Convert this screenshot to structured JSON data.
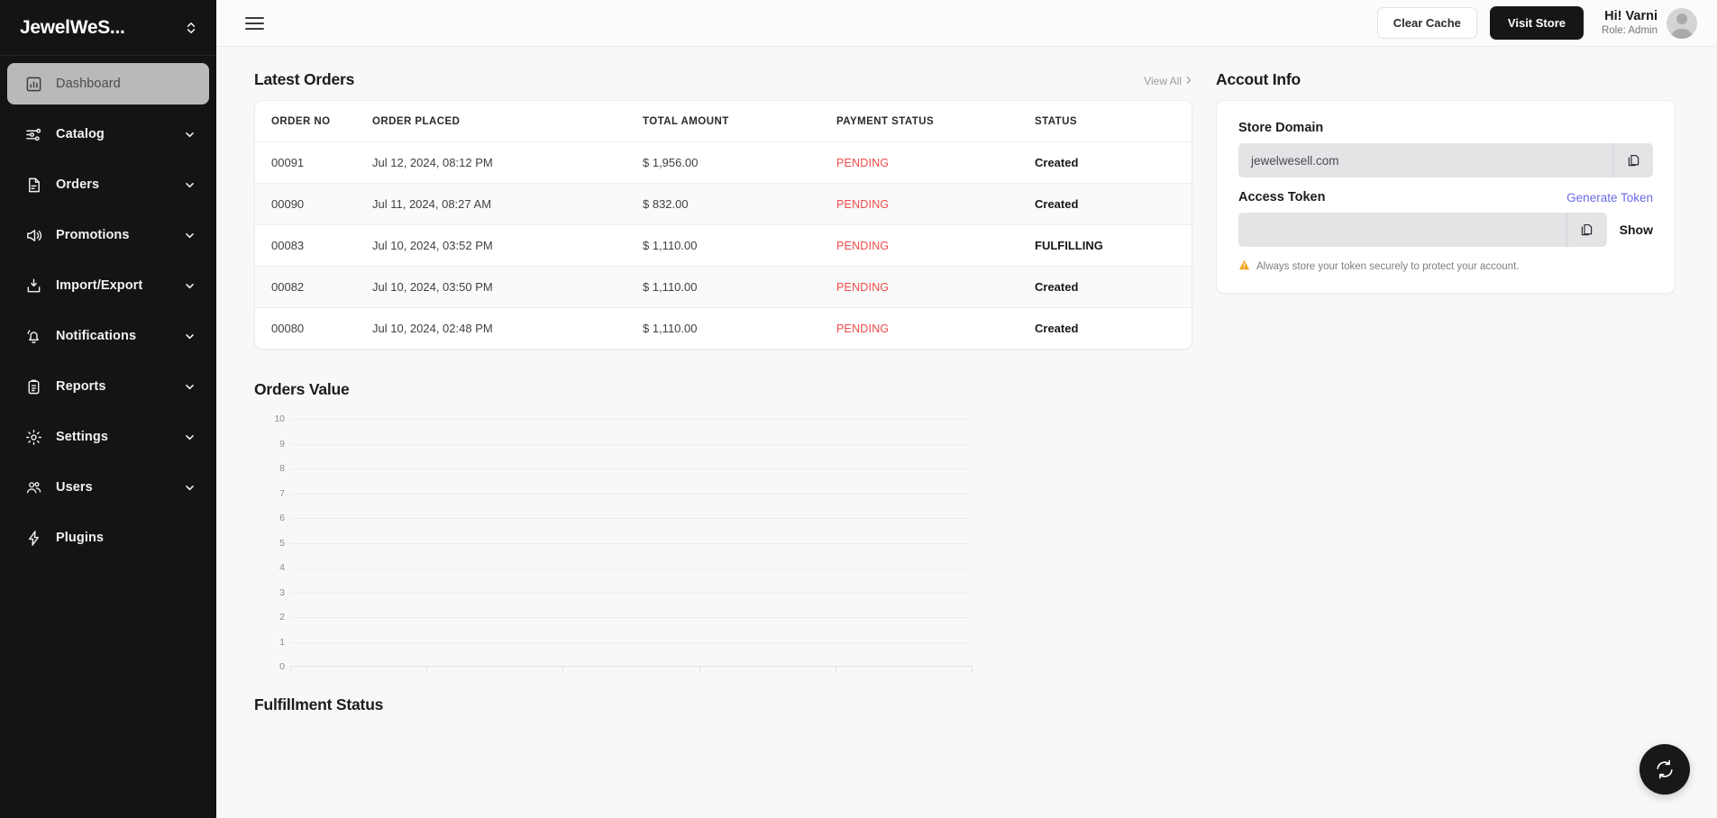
{
  "sidebar": {
    "brand": "JewelWeS...",
    "toggle_icon": "chevron-up-down-icon",
    "items": [
      {
        "label": "Dashboard",
        "icon": "chart-bar-icon",
        "active": true,
        "chevron": false
      },
      {
        "label": "Catalog",
        "icon": "sliders-icon",
        "active": false,
        "chevron": true
      },
      {
        "label": "Orders",
        "icon": "document-icon",
        "active": false,
        "chevron": true
      },
      {
        "label": "Promotions",
        "icon": "megaphone-icon",
        "active": false,
        "chevron": true
      },
      {
        "label": "Import/Export",
        "icon": "download-box-icon",
        "active": false,
        "chevron": true
      },
      {
        "label": "Notifications",
        "icon": "bell-icon",
        "active": false,
        "chevron": true
      },
      {
        "label": "Reports",
        "icon": "clipboard-icon",
        "active": false,
        "chevron": true
      },
      {
        "label": "Settings",
        "icon": "gear-icon",
        "active": false,
        "chevron": true
      },
      {
        "label": "Users",
        "icon": "users-icon",
        "active": false,
        "chevron": true
      },
      {
        "label": "Plugins",
        "icon": "bolt-icon",
        "active": false,
        "chevron": false
      }
    ]
  },
  "topbar": {
    "menu_icon": "hamburger-icon",
    "clear_cache_label": "Clear Cache",
    "visit_store_label": "Visit Store",
    "greeting": "Hi! Varni",
    "role": "Role: Admin",
    "avatar_icon": "user-avatar-icon"
  },
  "latest_orders": {
    "title": "Latest Orders",
    "view_all_label": "View All",
    "view_all_icon": "chevron-right-icon",
    "columns": [
      "ORDER NO",
      "ORDER PLACED",
      "TOTAL AMOUNT",
      "PAYMENT STATUS",
      "STATUS"
    ],
    "rows": [
      {
        "order_no": "00091",
        "placed": "Jul 12, 2024, 08:12 PM",
        "amount": "$ 1,956.00",
        "payment": "PENDING",
        "status": "Created"
      },
      {
        "order_no": "00090",
        "placed": "Jul 11, 2024, 08:27 AM",
        "amount": "$ 832.00",
        "payment": "PENDING",
        "status": "Created"
      },
      {
        "order_no": "00083",
        "placed": "Jul 10, 2024, 03:52 PM",
        "amount": "$ 1,110.00",
        "payment": "PENDING",
        "status": "FULFILLING"
      },
      {
        "order_no": "00082",
        "placed": "Jul 10, 2024, 03:50 PM",
        "amount": "$ 1,110.00",
        "payment": "PENDING",
        "status": "Created"
      },
      {
        "order_no": "00080",
        "placed": "Jul 10, 2024, 02:48 PM",
        "amount": "$ 1,110.00",
        "payment": "PENDING",
        "status": "Created"
      }
    ],
    "pending_color": "#ef4a4a"
  },
  "account_info": {
    "title": "Accout Info",
    "store_domain_label": "Store Domain",
    "store_domain_value": "jewelwesell.com",
    "access_token_label": "Access Token",
    "access_token_value": "",
    "generate_token_label": "Generate Token",
    "generate_token_color": "#6a6ae8",
    "show_label": "Show",
    "copy_icon": "copy-icon",
    "warning_icon": "warning-triangle-icon",
    "note": "Always store your token securely to protect your account."
  },
  "orders_value": {
    "title": "Orders Value"
  },
  "chart_data": {
    "type": "line",
    "title": "Orders Value",
    "xlabel": "",
    "ylabel": "",
    "ylim": [
      0,
      10
    ],
    "yticks": [
      "10",
      "9",
      "8",
      "7",
      "6",
      "5",
      "4",
      "3",
      "2",
      "1",
      "0"
    ],
    "xticks": [
      "",
      "",
      "",
      "",
      "",
      ""
    ],
    "grid": true,
    "legend": "none",
    "series": [
      {
        "name": "Orders Value",
        "values": []
      }
    ]
  },
  "fulfillment": {
    "title": "Fulfillment Status"
  },
  "fab": {
    "icon": "refresh-sync-icon"
  }
}
